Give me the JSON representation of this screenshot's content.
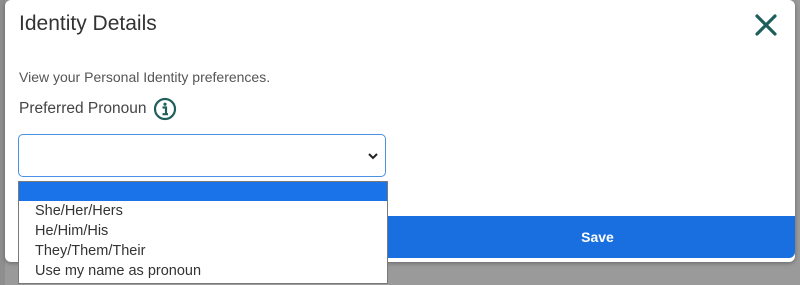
{
  "dialog": {
    "title": "Identity Details",
    "description": "View your Personal Identity preferences.",
    "pronoun_label": "Preferred Pronoun",
    "save_label": "Save"
  },
  "pronoun_select": {
    "selected_value": "",
    "options": [
      "",
      "She/Her/Hers",
      "He/Him/His",
      "They/Them/Their",
      "Use my name as pronoun"
    ]
  },
  "icons": {
    "close": "close-icon",
    "info": "info-icon",
    "dropdown": "chevron-down-icon"
  },
  "colors": {
    "accent": "#1a6fe0",
    "icon_teal": "#1f5f5b",
    "focus_border": "#4a90e2"
  }
}
